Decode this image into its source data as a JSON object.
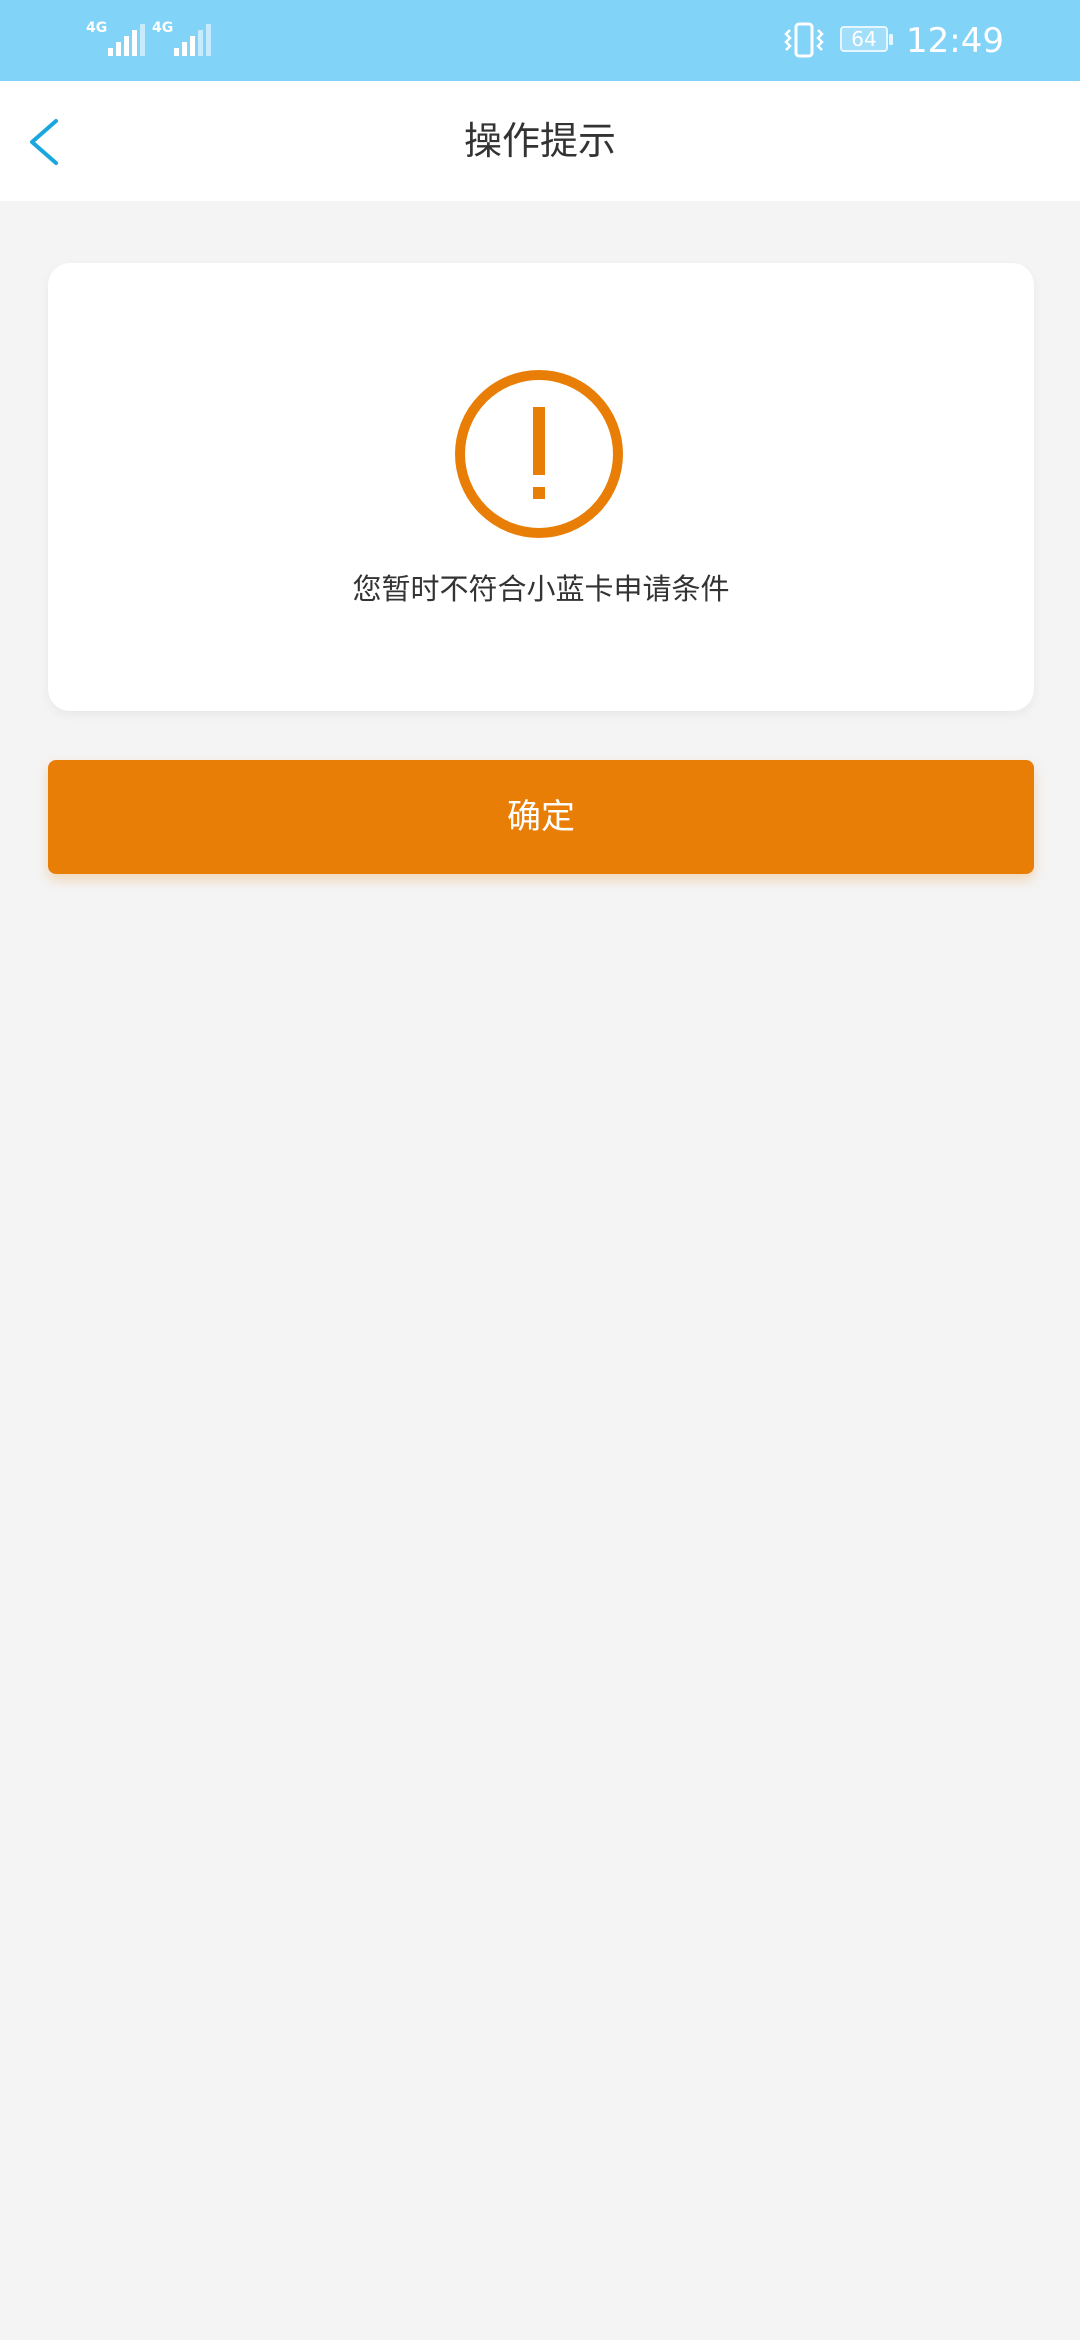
{
  "status_bar": {
    "sim1_network": "4G",
    "sim2_network": "4G",
    "battery_level": "64",
    "time": "12:49",
    "icons": [
      "signal-icon",
      "signal-icon",
      "vibrate-icon",
      "battery-icon"
    ]
  },
  "nav": {
    "title": "操作提示",
    "back_icon": "back-chevron-icon"
  },
  "card": {
    "icon": "warning-exclamation-icon",
    "message": "您暂时不符合小蓝卡申请条件"
  },
  "confirm_button": {
    "label": "确定"
  },
  "colors": {
    "status_bar": "#82d3f8",
    "accent_orange": "#e97e07",
    "back_icon_blue": "#1aa7de",
    "background": "#f4f4f4",
    "text": "#333333"
  }
}
